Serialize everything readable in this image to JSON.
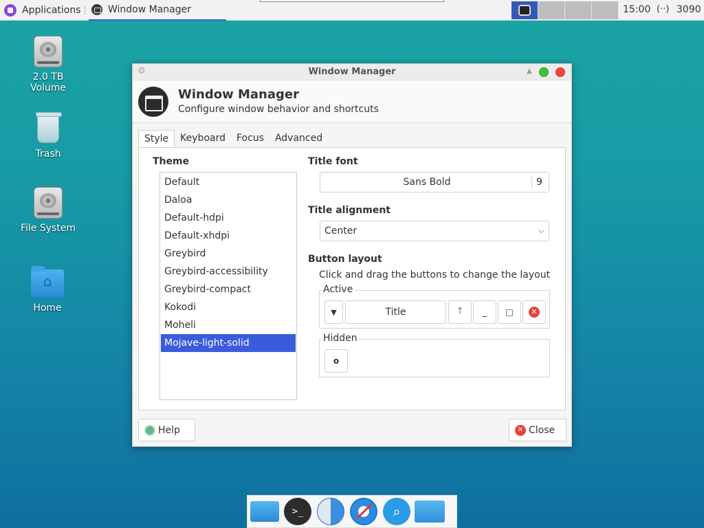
{
  "top_panel": {
    "applications_label": "Applications",
    "task_title": "Window Manager",
    "clock": "15:00",
    "network_icon": "network-icon",
    "network_text": "3090"
  },
  "desktop": {
    "icons": [
      {
        "label_line1": "2.0 TB",
        "label_line2": "Volume",
        "icon": "drive-icon"
      },
      {
        "label_line1": "Trash",
        "icon": "trash-icon"
      },
      {
        "label_line1": "File System",
        "icon": "drive-icon"
      },
      {
        "label_line1": "Home",
        "icon": "home-folder-icon"
      }
    ]
  },
  "window": {
    "title": "Window Manager",
    "header_title": "Window Manager",
    "header_subtitle": "Configure window behavior and shortcuts",
    "tabs": [
      "Style",
      "Keyboard",
      "Focus",
      "Advanced"
    ],
    "active_tab": "Style",
    "theme_label": "Theme",
    "themes": [
      "Default",
      "Daloa",
      "Default-hdpi",
      "Default-xhdpi",
      "Greybird",
      "Greybird-accessibility",
      "Greybird-compact",
      "Kokodi",
      "Moheli",
      "Mojave-light-solid"
    ],
    "selected_theme": "Mojave-light-solid",
    "title_font_label": "Title font",
    "title_font_name": "Sans Bold",
    "title_font_size": "9",
    "title_alignment_label": "Title alignment",
    "title_alignment_value": "Center",
    "button_layout_label": "Button layout",
    "button_layout_hint": "Click and drag the buttons to change the layout",
    "active_label": "Active",
    "active_title": "Title",
    "hidden_label": "Hidden",
    "help_label": "Help",
    "close_label": "Close"
  },
  "colors": {
    "selection": "#3a5bdc",
    "accent_blue": "#3d64d4",
    "close_red": "#f2453d",
    "maximize_green": "#3cc13b"
  },
  "dock": {
    "items": [
      "files-icon",
      "terminal-icon",
      "finder-icon",
      "safari-icon",
      "search-icon",
      "folder-icon"
    ]
  }
}
